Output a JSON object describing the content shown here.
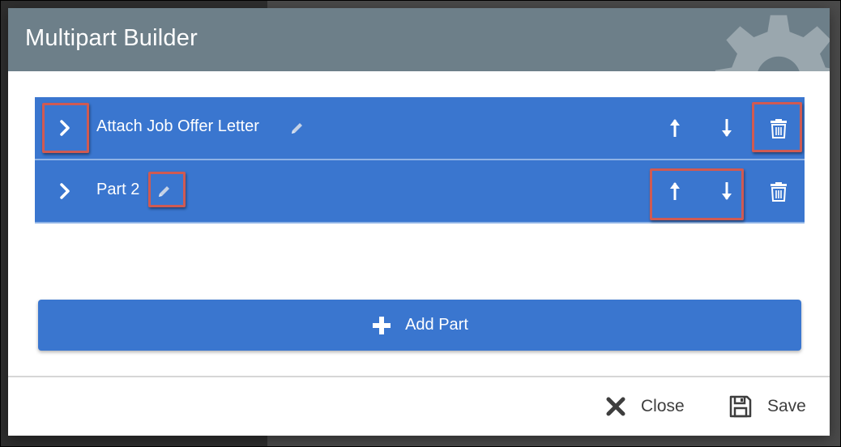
{
  "modal": {
    "title": "Multipart Builder"
  },
  "parts": [
    {
      "label": "Attach Job Offer Letter"
    },
    {
      "label": "Part 2"
    }
  ],
  "actions": {
    "add_part_label": "Add Part",
    "close_label": "Close",
    "save_label": "Save"
  },
  "icons": {
    "expand": "chevron-right-icon",
    "edit": "pencil-icon",
    "move_up": "arrow-up-icon",
    "move_down": "arrow-down-icon",
    "delete": "trash-icon",
    "add": "plus-icon",
    "close": "x-icon",
    "save": "floppy-disk-icon",
    "header_decoration": "gear-icon"
  },
  "colors": {
    "header_bg": "#6d7f89",
    "row_bg": "#3a76cf",
    "highlight": "#d05a52",
    "footer_text": "#3e3e3e"
  }
}
